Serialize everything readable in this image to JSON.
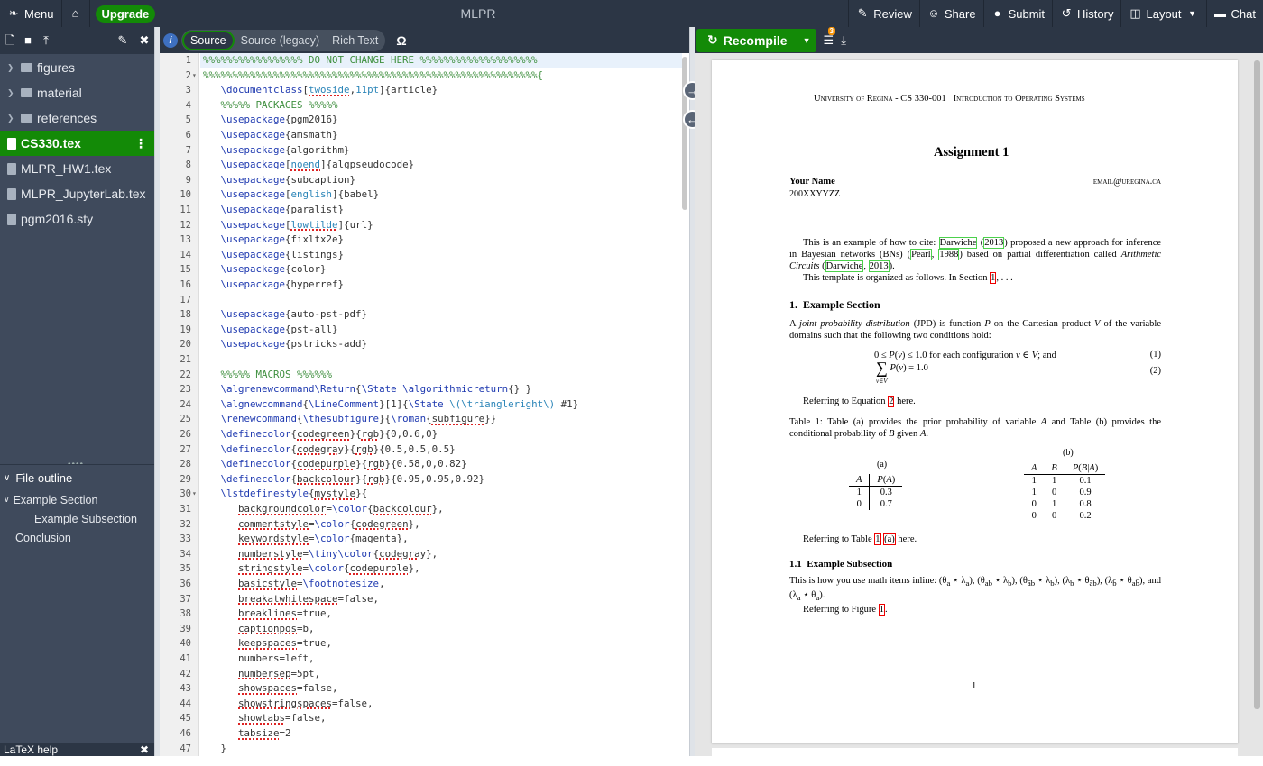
{
  "topbar": {
    "menu_label": "Menu",
    "upgrade_label": "Upgrade",
    "project_title": "MLPR",
    "review_label": "Review",
    "share_label": "Share",
    "submit_label": "Submit",
    "history_label": "History",
    "layout_label": "Layout",
    "chat_label": "Chat"
  },
  "files": [
    {
      "name": "figures",
      "type": "folder"
    },
    {
      "name": "material",
      "type": "folder"
    },
    {
      "name": "references",
      "type": "folder"
    },
    {
      "name": "CS330.tex",
      "type": "file",
      "active": true
    },
    {
      "name": "MLPR_HW1.tex",
      "type": "file"
    },
    {
      "name": "MLPR_JupyterLab.tex",
      "type": "file"
    },
    {
      "name": "pgm2016.sty",
      "type": "file"
    }
  ],
  "outline": {
    "header": "File outline",
    "items": [
      "Example Section",
      "Example Subsection",
      "Conclusion"
    ]
  },
  "latex_help": "LaTeX help",
  "editor": {
    "mode_source": "Source",
    "mode_legacy": "Source (legacy)",
    "mode_rich": "Rich Text",
    "omega": "Ω"
  },
  "pdf": {
    "recompile_label": "Recompile",
    "log_badge": "3",
    "header": "University of Regina - CS 330-001   Introduction to Operating Systems",
    "assignment_title": "Assignment 1",
    "author_name": "Your Name",
    "author_id": "200XXYYZZ",
    "author_email": "email@uregina.ca",
    "page_number": "1"
  },
  "colors": {
    "topbar": "#2c3645",
    "sidebar": "#3f4a5c",
    "accent_green": "#138a07"
  }
}
